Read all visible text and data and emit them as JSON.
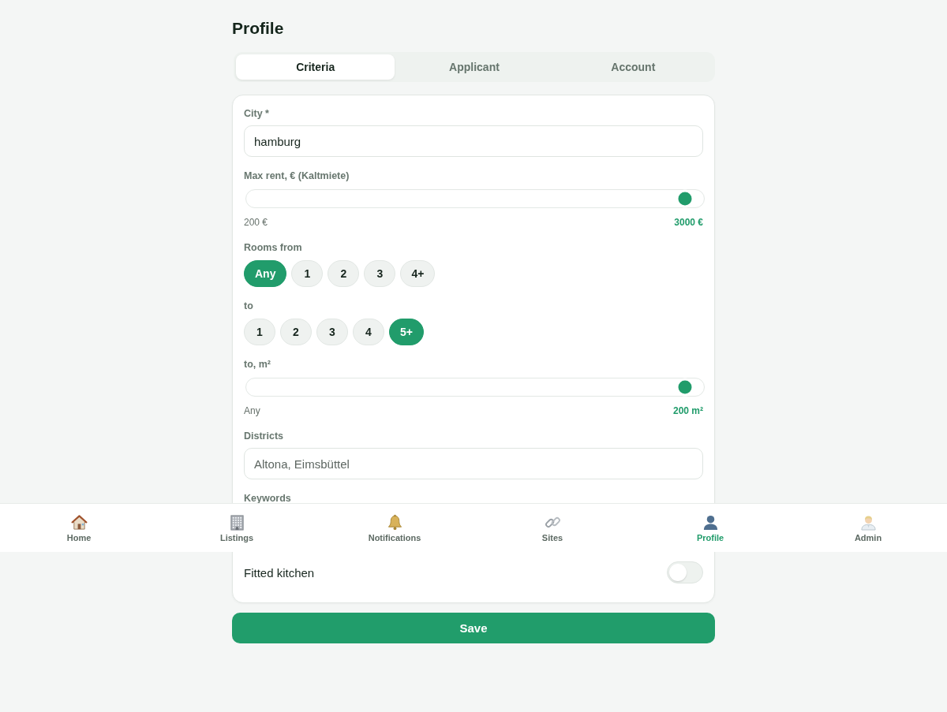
{
  "page": {
    "title": "Profile"
  },
  "tabs": [
    {
      "label": "Criteria",
      "selected": true
    },
    {
      "label": "Applicant",
      "selected": false
    },
    {
      "label": "Account",
      "selected": false
    }
  ],
  "form": {
    "fields": [
      {
        "kind": "text",
        "label": "City *",
        "value": "hamburg"
      },
      {
        "kind": "slider",
        "label": "Max rent, € (Kaltmiete)",
        "level": 1,
        "min_label": "200 €",
        "reading": "3000 €"
      },
      {
        "kind": "chips",
        "label": "Rooms from",
        "options": [
          {
            "label": "Any",
            "selected": true
          },
          {
            "label": "1",
            "selected": false
          },
          {
            "label": "2",
            "selected": false
          },
          {
            "label": "3",
            "selected": false
          },
          {
            "label": "4+",
            "selected": false
          }
        ]
      },
      {
        "kind": "chips",
        "label": "to",
        "options": [
          {
            "label": "1",
            "selected": false
          },
          {
            "label": "2",
            "selected": false
          },
          {
            "label": "3",
            "selected": false
          },
          {
            "label": "4",
            "selected": false
          },
          {
            "label": "5+",
            "selected": true
          }
        ]
      },
      {
        "kind": "slider",
        "label": "to, m²",
        "level": 1,
        "min_label": "Any",
        "reading": "200 m²"
      },
      {
        "kind": "text",
        "label": "Districts",
        "placeholder": "Altona, Eimsbüttel"
      },
      {
        "kind": "label",
        "label": "Keywords"
      },
      {
        "kind": "toggle",
        "label": "Fitted kitchen",
        "on": false
      }
    ]
  },
  "save_button": "Save",
  "nav": {
    "items": [
      {
        "kind": "house",
        "label": "Home",
        "selected": false
      },
      {
        "kind": "building",
        "label": "Listings",
        "selected": false
      },
      {
        "kind": "bell",
        "label": "Notifications",
        "selected": false
      },
      {
        "kind": "link",
        "label": "Sites",
        "selected": false
      },
      {
        "kind": "person",
        "label": "Profile",
        "selected": true
      },
      {
        "kind": "man",
        "label": "Admin",
        "selected": false
      }
    ]
  }
}
